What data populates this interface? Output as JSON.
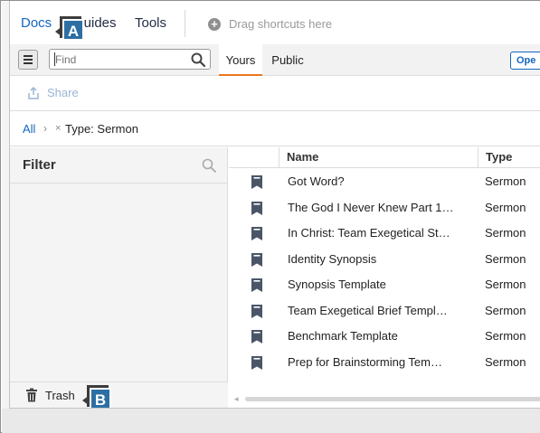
{
  "nav": {
    "tabs": [
      "Docs",
      "Guides",
      "Tools"
    ],
    "shortcuts_hint": "Drag shortcuts here"
  },
  "callouts": {
    "a": "A",
    "b": "B"
  },
  "toolbar": {
    "find_placeholder": "Find",
    "tabs": [
      "Yours",
      "Public"
    ],
    "open_label": "Ope"
  },
  "share": {
    "label": "Share"
  },
  "breadcrumb": {
    "root": "All",
    "chevron": "›",
    "remove": "×",
    "filter": "Type: Sermon"
  },
  "filter": {
    "title": "Filter",
    "trash_label": "Trash"
  },
  "table": {
    "columns": [
      "Name",
      "Type"
    ],
    "rows": [
      {
        "name": "Got Word?",
        "type": "Sermon"
      },
      {
        "name": "The God I Never Knew Part 1…",
        "type": "Sermon"
      },
      {
        "name": "In Christ: Team Exegetical St…",
        "type": "Sermon"
      },
      {
        "name": "Identity Synopsis",
        "type": "Sermon"
      },
      {
        "name": "Synopsis Template",
        "type": "Sermon"
      },
      {
        "name": "Team Exegetical Brief Templ…",
        "type": "Sermon"
      },
      {
        "name": "Benchmark Template",
        "type": "Sermon"
      },
      {
        "name": "Prep for Brainstorming Tem…",
        "type": "Sermon"
      }
    ]
  },
  "colors": {
    "accent_blue": "#1565c0",
    "active_tab_underline": "#e87722",
    "badge_blue": "#2d6fa3",
    "doc_icon": "#4a5568"
  }
}
